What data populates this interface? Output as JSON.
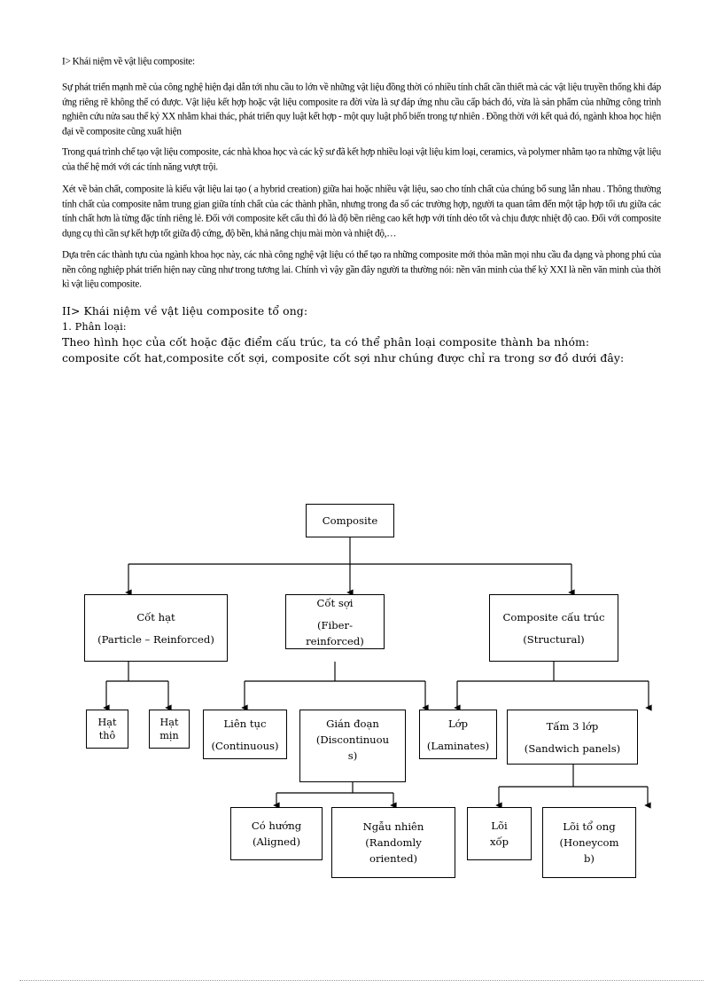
{
  "document": {
    "section1": {
      "heading": "I> Khái niệm về vật liệu composite:",
      "paragraphs": [
        "Sự phát triển mạnh mẽ của công nghệ hiện đại dẫn tới nhu cầu to lớn về những vật liệu đồng thời có nhiều tính chất cần thiết mà các vật liệu truyền thống khi đáp ứng riêng rẽ không thể có được. Vật liệu kết hợp hoặc vật liệu composite ra đời vừa là sự đáp ứng nhu cầu cấp bách đó, vừa là sản phẩm của những công trình nghiên cứu nửa sau thế kỷ XX nhằm khai thác, phát triển quy luật kết hợp - một quy luật phổ biến trong tự nhiên . Đồng thời với kết quả đó, ngành khoa học hiện đại về composite cũng xuất hiện",
        "Trong quá trình chế tạo vật liệu composite, các nhà khoa học và các kỹ sư đã kết hợp nhiều loại vật liệu kim loại, ceramics, và polymer nhằm tạo ra những vật liệu của thế hệ mới với các tính năng vượt trội.",
        "Xét về bản chất, composite là kiểu vật liệu lai tạo ( a hybrid creation) giữa hai hoặc nhiều vật liệu, sao cho tính chất của chúng bổ sung lẫn nhau . Thông thường tính chất của composite nằm trung gian giữa tính chất của các thành phần, nhưng trong đa số các trường hợp, người ta quan tâm đến một tập hợp tối ưu giữa các tính chất hơn là từng đặc tính riêng lẻ. Đối với composite kết cấu thì đó là độ bền riêng cao kết hợp với tính dẻo tốt và chịu được nhiệt độ cao. Đối với composite dụng cụ thì cần sự kết hợp tốt giữa độ cứng, độ bền, khả năng chịu mài mòn và nhiệt độ,…",
        "Dựa trên các thành tựu của ngành khoa học này, các nhà công nghệ vật liệu có thể tạo ra những composite mới thỏa mãn mọi nhu cầu đa dạng và phong phú của nền công nghiệp phát triển hiện nay cũng như trong tương lai. Chính vì vậy gần đây người ta thường nói: nền văn minh của thế kỷ XXI là nền văn minh của thời kì vật liệu composite."
      ]
    },
    "section2": {
      "heading": "II> Khái niệm về vật liệu composite tổ ong:",
      "list_item": "1.   Phân loại:",
      "intro_line1": "Theo hình học của cốt hoặc đặc điểm cấu trúc, ta có thể phân  loại composite thành ba nhóm:",
      "intro_line2": "composite cốt hat,composite cốt sợi, composite cốt sợi như chúng được chỉ ra trong sơ đồ dưới đây:"
    }
  },
  "diagram": {
    "nodes": {
      "root": {
        "line1": "Composite"
      },
      "particle": {
        "line1": "Cốt hạt",
        "line2": "(Particle – Reinforced)"
      },
      "fiber": {
        "line1": "Cốt sợi",
        "line2": "(Fiber- reinforced)"
      },
      "structural": {
        "line1": "Composite cấu trúc",
        "line2": "(Structural)"
      },
      "coarse": {
        "line1": "Hạt",
        "line2": "thô"
      },
      "fine": {
        "line1": "Hạt",
        "line2": "mịn"
      },
      "continuous": {
        "line1": "Liên tục",
        "line2": "(Continuous)"
      },
      "discontinuous": {
        "line1": "Gián đoạn",
        "line2": "(Discontinuou",
        "line3": "s)"
      },
      "laminates": {
        "line1": "Lớp",
        "line2": "(Laminates)"
      },
      "sandwich": {
        "line1": "Tấm 3 lớp",
        "line2": "(Sandwich panels)"
      },
      "aligned": {
        "line1": "Có hướng",
        "line2": "(Aligned)"
      },
      "random": {
        "line1": "Ngẫu nhiên",
        "line2": "(Randomly",
        "line3": "oriented)"
      },
      "foam_core": {
        "line1": "Lõi",
        "line2": "xốp"
      },
      "honeycomb": {
        "line1": "Lõi tổ ong",
        "line2": "(Honeycom",
        "line3": "b)"
      }
    }
  },
  "colors": {
    "page_background": "#ffffff",
    "text": "#000000",
    "line": "#000000"
  }
}
